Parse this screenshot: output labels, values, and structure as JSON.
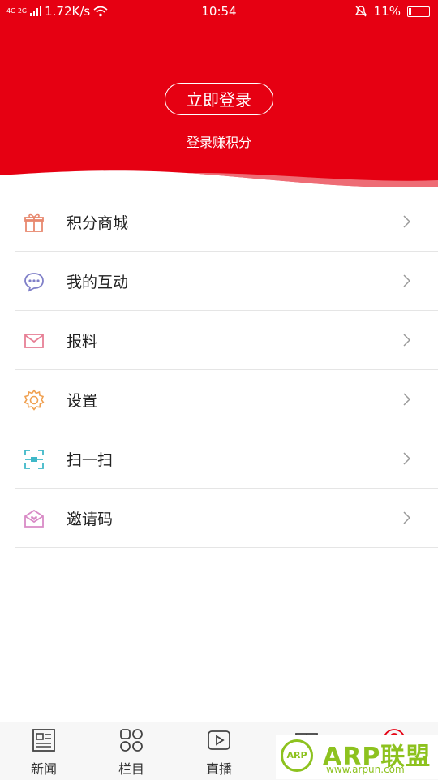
{
  "status_bar": {
    "network": "4G 2G",
    "speed": "1.72K/s",
    "time": "10:54",
    "battery": "11%"
  },
  "header": {
    "login_button": "立即登录",
    "subtitle": "登录赚积分",
    "bg_color": "#e60012"
  },
  "menu": {
    "items": [
      {
        "label": "积分商城",
        "icon": "gift-icon"
      },
      {
        "label": "我的互动",
        "icon": "chat-bubble-icon"
      },
      {
        "label": "报料",
        "icon": "mail-icon"
      },
      {
        "label": "设置",
        "icon": "gear-icon"
      },
      {
        "label": "扫一扫",
        "icon": "scan-icon"
      },
      {
        "label": "邀请码",
        "icon": "invite-envelope-icon"
      }
    ]
  },
  "tabbar": {
    "tabs": [
      {
        "label": "新闻",
        "icon": "newspaper-icon"
      },
      {
        "label": "栏目",
        "icon": "grid-icon"
      },
      {
        "label": "直播",
        "icon": "play-icon"
      },
      {
        "label": "",
        "icon": "gift-icon"
      },
      {
        "label": "",
        "icon": "profile-icon"
      }
    ]
  },
  "watermark": {
    "logo_text": "ARP",
    "title": "ARP联盟",
    "url": "www.arpun.com"
  }
}
